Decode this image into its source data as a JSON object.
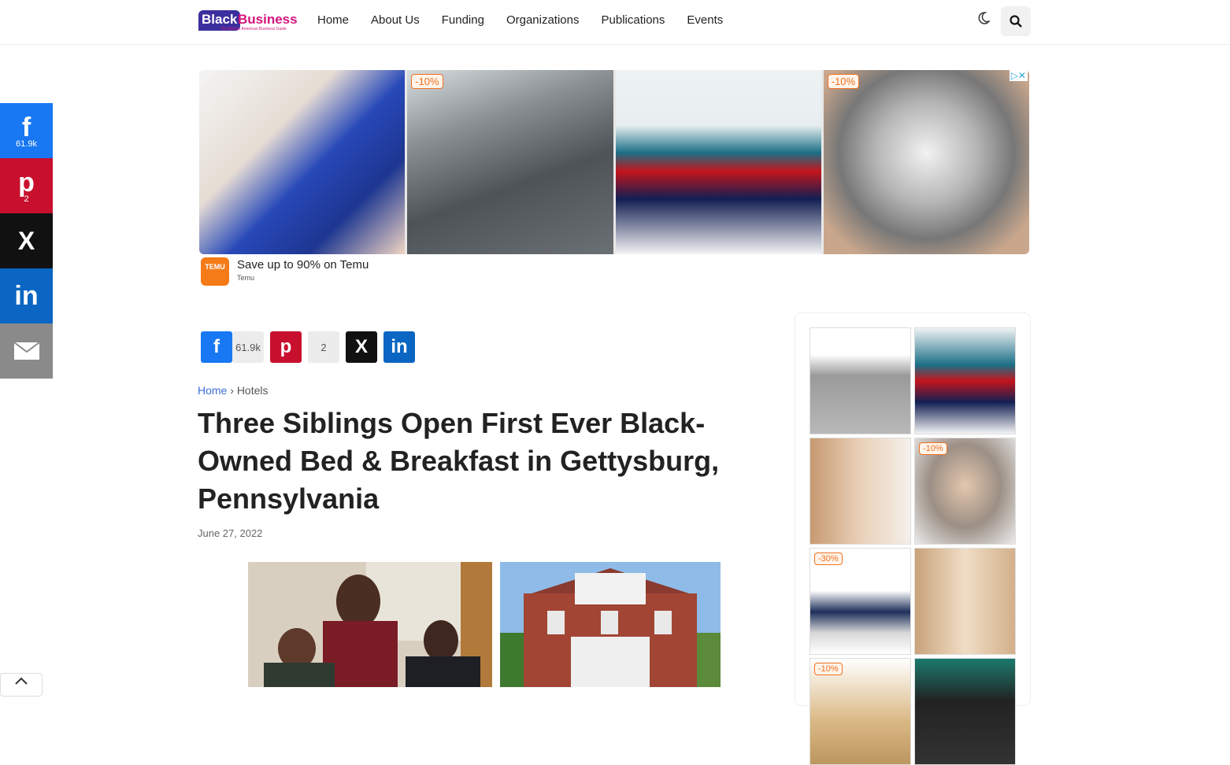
{
  "header": {
    "logo": {
      "word1": "Black",
      "word2": "Business",
      "tagline": "The African American Business Guide"
    },
    "nav": [
      "Home",
      "About Us",
      "Funding",
      "Organizations",
      "Publications",
      "Events"
    ],
    "icons": [
      "moon-icon",
      "search-icon"
    ]
  },
  "share_rail": {
    "facebook_count": "61.9k",
    "pinterest_count": "2",
    "items": [
      "facebook",
      "pinterest",
      "x",
      "linkedin",
      "email"
    ]
  },
  "top_ad": {
    "tiles": [
      {
        "badge": ""
      },
      {
        "badge": "-10%"
      },
      {
        "badge": ""
      },
      {
        "badge": "-10%"
      }
    ],
    "brand_logo_text": "TEMU",
    "headline": "Save up to 90% on Temu",
    "source": "Temu"
  },
  "share_row": {
    "facebook_count": "61.9k",
    "pinterest_count": "2"
  },
  "article": {
    "breadcrumb_home": "Home",
    "breadcrumb_sep": "›",
    "breadcrumb_category": "Hotels",
    "title": "Three Siblings Open First Ever Black-Owned Bed & Breakfast in Gettysburg, Pennsylvania",
    "date": "June 27, 2022"
  },
  "side_ad": {
    "tiles": [
      {
        "badge": ""
      },
      {
        "badge": ""
      },
      {
        "badge": ""
      },
      {
        "badge": "-10%"
      },
      {
        "badge": "-30%"
      },
      {
        "badge": ""
      },
      {
        "badge": "-10%"
      },
      {
        "badge": ""
      }
    ]
  },
  "colors": {
    "facebook": "#1877f2",
    "pinterest": "#c8102e",
    "x": "#111111",
    "linkedin": "#0a66c2",
    "email": "#8a8a8a",
    "link": "#3b6ed6",
    "badge": "#f07020"
  }
}
